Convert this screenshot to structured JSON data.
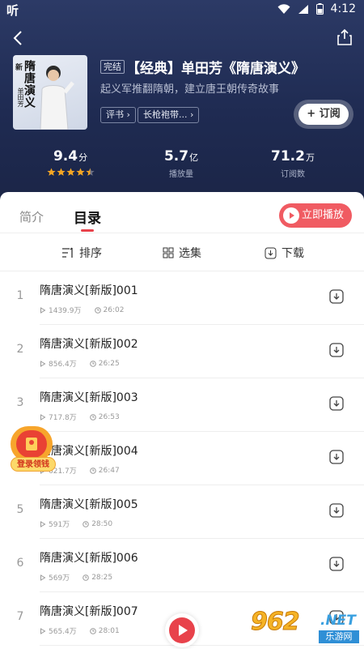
{
  "status_bar": {
    "left_label": "听",
    "time": "4:12"
  },
  "album": {
    "cover_title": "隋唐演义",
    "cover_sub": "单田芳",
    "cover_prefix": "新",
    "badge": "完结",
    "title": "【经典】单田芳《隋唐演义》",
    "description": "起义军推翻隋朝，建立唐王朝传奇故事",
    "tags": [
      "评书 ›",
      "长枪袍带... ›"
    ],
    "subscribe_label": "+ 订阅"
  },
  "stats": [
    {
      "value": "9.4",
      "unit": "分",
      "label": "",
      "rating": 4.5
    },
    {
      "value": "5.7",
      "unit": "亿",
      "label": "播放量"
    },
    {
      "value": "71.2",
      "unit": "万",
      "label": "订阅数"
    }
  ],
  "tabs": {
    "intro": "简介",
    "catalog": "目录",
    "play_now": "立即播放"
  },
  "toolbar": {
    "sort": "排序",
    "select": "选集",
    "download": "下载"
  },
  "episodes": [
    {
      "index": "1",
      "title": "隋唐演义[新版]001",
      "plays": "1439.9万",
      "duration": "26:02"
    },
    {
      "index": "2",
      "title": "隋唐演义[新版]002",
      "plays": "856.4万",
      "duration": "26:25"
    },
    {
      "index": "3",
      "title": "隋唐演义[新版]003",
      "plays": "717.8万",
      "duration": "26:53"
    },
    {
      "index": "4",
      "title": "隋唐演义[新版]004",
      "plays": "621.7万",
      "duration": "26:47"
    },
    {
      "index": "5",
      "title": "隋唐演义[新版]005",
      "plays": "591万",
      "duration": "28:50"
    },
    {
      "index": "6",
      "title": "隋唐演义[新版]006",
      "plays": "569万",
      "duration": "28:25"
    },
    {
      "index": "7",
      "title": "隋唐演义[新版]007",
      "plays": "565.4万",
      "duration": "28:01"
    }
  ],
  "redpacket": {
    "label": "登录领钱"
  },
  "watermark": {
    "number": "962",
    "suffix": ".NET",
    "sub": "乐游网"
  },
  "colors": {
    "accent": "#e8424b",
    "header_bg": "#1f2b52",
    "star": "#f5a623"
  }
}
